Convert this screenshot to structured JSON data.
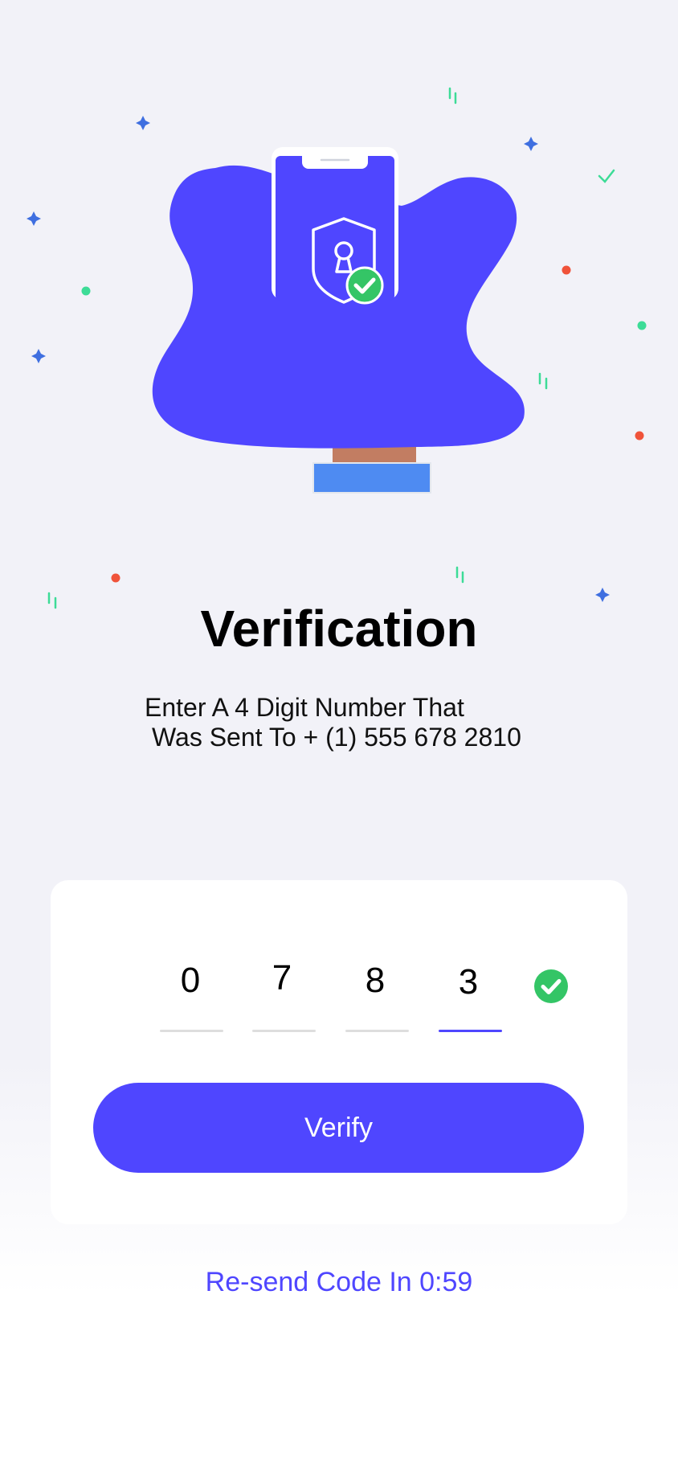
{
  "screen": {
    "title": "Verification",
    "subtitle_line1": "Enter A 4 Digit Number That",
    "subtitle_line2": "Was Sent To + (1) 555 678 2810"
  },
  "code": {
    "digits": [
      "0",
      "7",
      "8",
      "3"
    ],
    "status": "verified"
  },
  "actions": {
    "verify_label": "Verify",
    "resend_label": "Re-send Code In 0:59"
  },
  "colors": {
    "accent": "#4f46ff",
    "success": "#34c566",
    "confetti_red": "#f0533a",
    "confetti_green": "#3ddc97",
    "confetti_blue": "#3f6fe0"
  },
  "icons": {
    "illustration": "phone-shield-lock-illustration",
    "success": "check-circle-icon"
  }
}
